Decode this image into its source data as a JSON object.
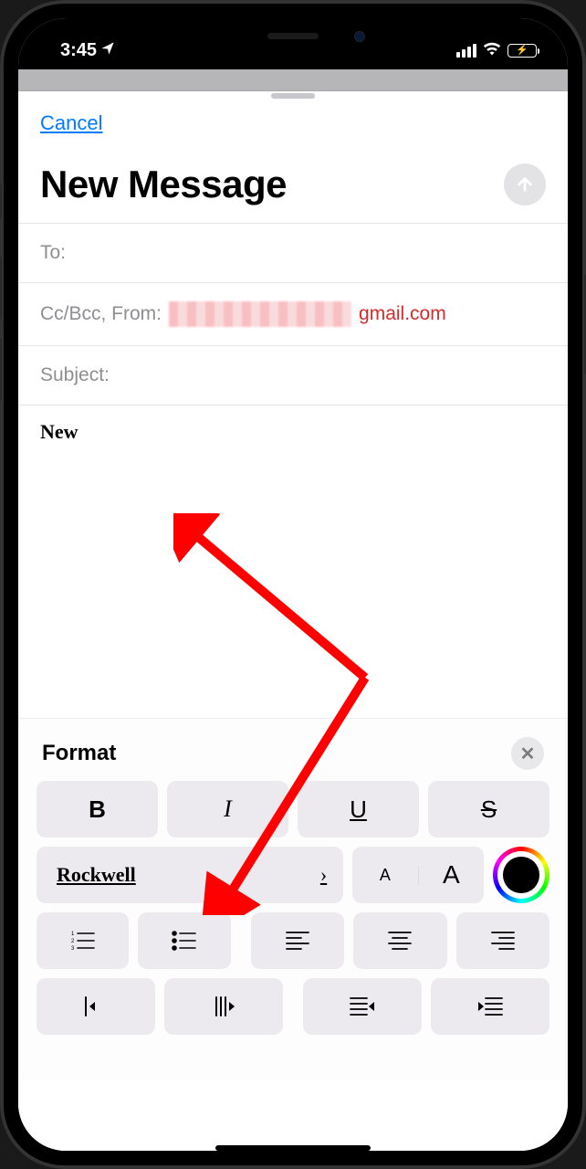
{
  "status": {
    "time": "3:45",
    "location_arrow": "➤"
  },
  "nav": {
    "cancel_label": "Cancel"
  },
  "compose": {
    "title": "New Message",
    "to_label": "To:",
    "ccbcc_label": "Cc/Bcc, From:",
    "from_domain": "gmail.com",
    "subject_label": "Subject:",
    "body_text": "New"
  },
  "format": {
    "title": "Format",
    "bold": "B",
    "italic": "I",
    "underline": "U",
    "strike": "S",
    "font_name": "Rockwell",
    "chevron": "›",
    "size_small": "A",
    "size_large": "A"
  }
}
